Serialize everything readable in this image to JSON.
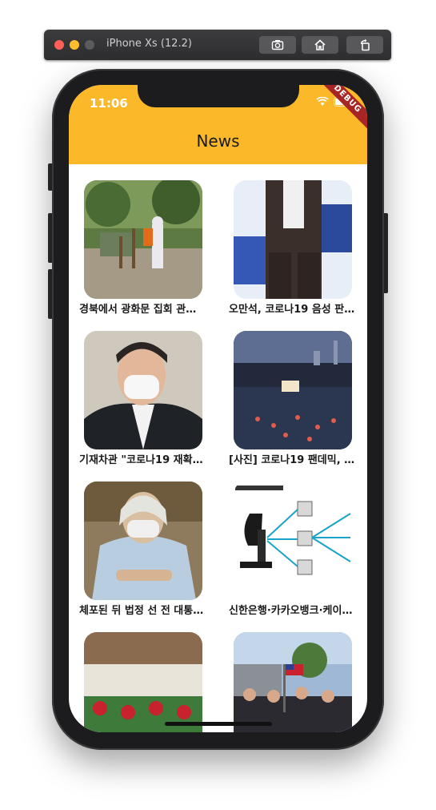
{
  "simulator": {
    "title": "iPhone Xs (12.2)",
    "buttons": [
      {
        "icon": "camera-icon"
      },
      {
        "icon": "home-icon"
      },
      {
        "icon": "rotate-icon"
      }
    ]
  },
  "status_bar": {
    "time": "11:06",
    "debug_banner": "DEBUG"
  },
  "app_bar": {
    "title": "News"
  },
  "articles": [
    {
      "caption": "경북에서 광화문 집회 관련..."
    },
    {
      "caption": "오만석, 코로나19 음성 판정..."
    },
    {
      "caption": "기재차관 \"코로나19 재확산..."
    },
    {
      "caption": "[사진] 코로나19 팬데믹, 드..."
    },
    {
      "caption": "체포된 뒤 법정 선 전 대통령..."
    },
    {
      "caption": "신한은행·카카오뱅크·케이뱅..."
    },
    {
      "caption": ""
    },
    {
      "caption": ""
    }
  ],
  "colors": {
    "app_bar": "#fbb829",
    "debug": "#a82525"
  }
}
